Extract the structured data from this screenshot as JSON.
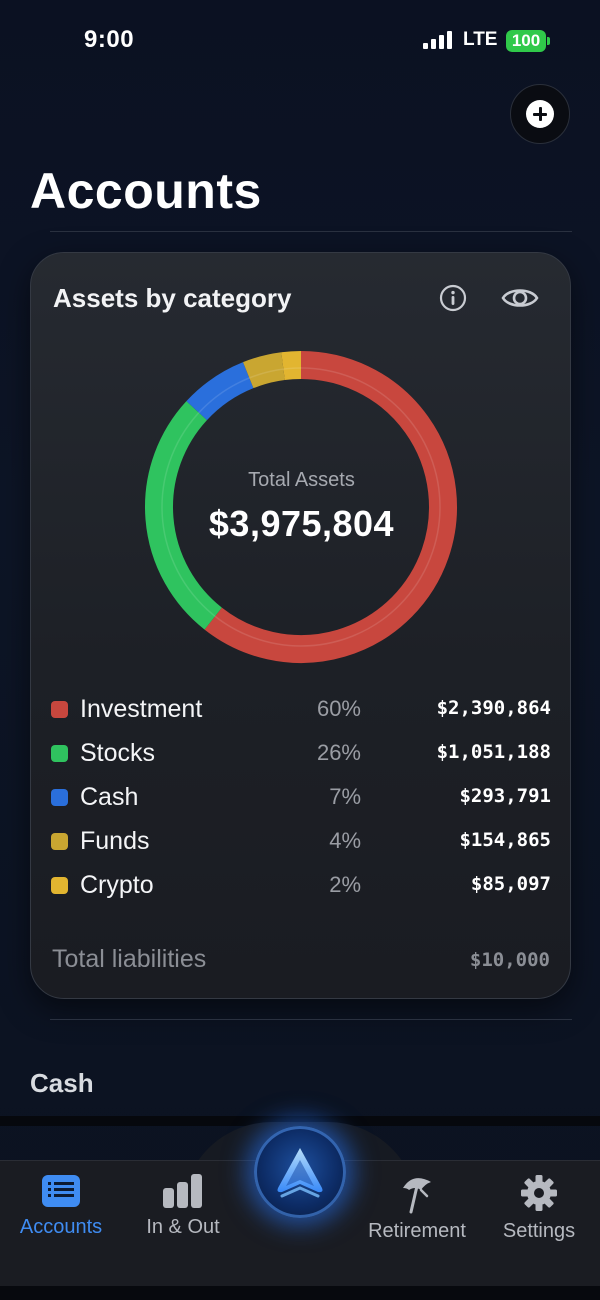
{
  "status_bar": {
    "time": "9:00",
    "network": "LTE",
    "battery": "100"
  },
  "header": {
    "title": "Accounts"
  },
  "card": {
    "title": "Assets by category",
    "total_label": "Total Assets",
    "total_value": "$3,975,804",
    "categories": [
      {
        "name": "Investment",
        "percent": "60%",
        "amount": "$2,390,864",
        "share": 0.6,
        "color": "#c8473e"
      },
      {
        "name": "Stocks",
        "percent": "26%",
        "amount": "$1,051,188",
        "share": 0.26,
        "color": "#2fc35f"
      },
      {
        "name": "Cash",
        "percent": "7%",
        "amount": "$293,791",
        "share": 0.07,
        "color": "#2a6fdc"
      },
      {
        "name": "Funds",
        "percent": "4%",
        "amount": "$154,865",
        "share": 0.04,
        "color": "#c9a631"
      },
      {
        "name": "Crypto",
        "percent": "2%",
        "amount": "$85,097",
        "share": 0.02,
        "color": "#e2b530"
      }
    ],
    "liabilities_label": "Total liabilities",
    "liabilities_value": "$10,000"
  },
  "sections": {
    "cash_title": "Cash"
  },
  "tab_bar": {
    "items": [
      {
        "label": "Accounts",
        "icon": "list-icon",
        "active": true
      },
      {
        "label": "In & Out",
        "icon": "bar-chart-icon",
        "active": false
      },
      {
        "label": "Retirement",
        "icon": "beach-umbrella-icon",
        "active": false
      },
      {
        "label": "Settings",
        "icon": "gear-icon",
        "active": false
      }
    ],
    "center_icon": "app-logo-icon"
  },
  "colors": {
    "accent": "#3f8cf2",
    "background": "#0b1120",
    "card": "#1f2228"
  }
}
